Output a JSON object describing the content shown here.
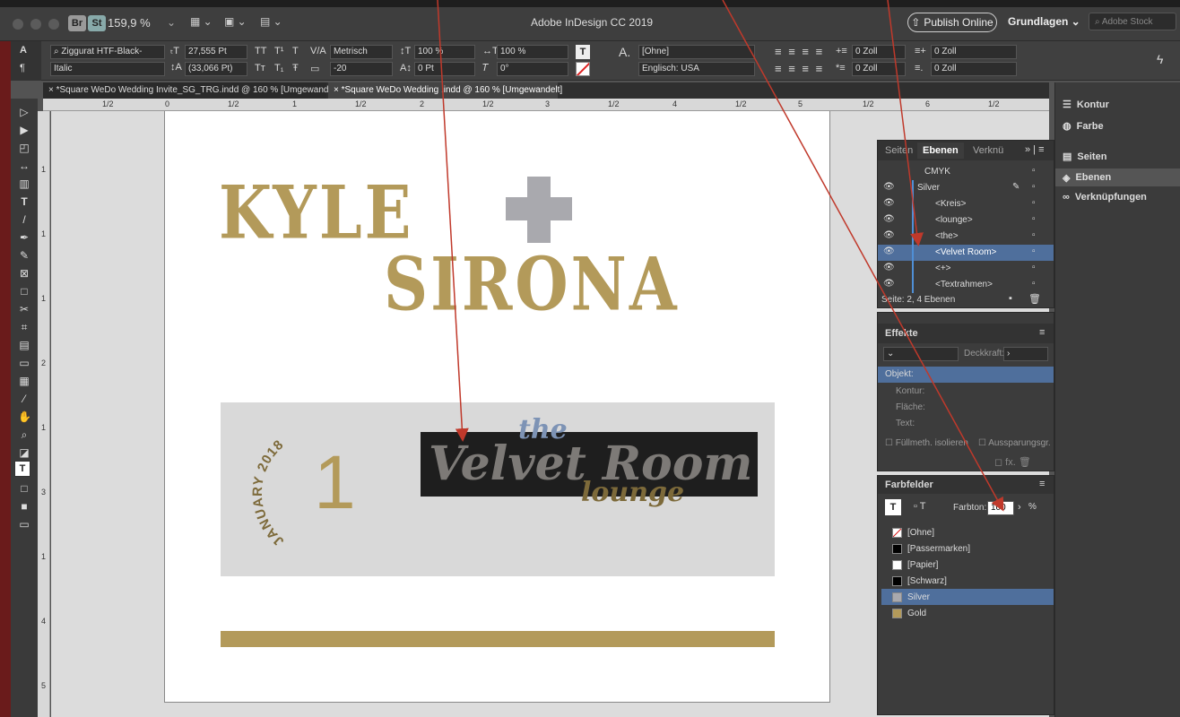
{
  "app": {
    "window_title": "Adobe InDesign CC 2019",
    "zoom": "159,9 %",
    "publish_label": "Publish Online",
    "workspace_label": "Grundlagen",
    "stock_placeholder": "Adobe Stock",
    "badge_br": "Br",
    "badge_st": "St"
  },
  "control": {
    "font_family": "Ziggurat HTF-Black-",
    "font_style": "Italic",
    "font_size": "27,555 Pt",
    "leading": "(33,066 Pt)",
    "kerning": "Metrisch",
    "tracking": "-20",
    "vscale": "100 %",
    "hscale": "100 %",
    "baseline": "0 Pt",
    "skew": "0°",
    "char_style": "[Ohne]",
    "language": "Englisch: USA",
    "indent_left": "0 Zoll",
    "indent_first": "0 Zoll",
    "indent_right": "0 Zoll",
    "indent_last": "0 Zoll",
    "space_before": "0 Zoll",
    "space_after": "0 Zoll",
    "tt1": "TT",
    "tt2": "T¹",
    "tt3": "T",
    "tt4": "Tт",
    "tt5": "T₁",
    "tt6": "Ŧ"
  },
  "tabs": [
    {
      "label": "*Square WeDo Wedding Invite_SG_TRG.indd @ 160 % [Umgewandelt]"
    },
    {
      "label": "*Square WeDo Wedding .indd @ 160 % [Umgewandelt]"
    }
  ],
  "ruler_h": [
    "1/2",
    "0",
    "1/2",
    "1",
    "1/2",
    "2",
    "1/2",
    "3",
    "1/2",
    "4",
    "1/2",
    "5",
    "1/2",
    "6",
    "1/2"
  ],
  "ruler_v": [
    "1",
    "1",
    "1",
    "2",
    "1",
    "3",
    "1",
    "4",
    "1",
    "5"
  ],
  "document": {
    "name_line1": "KYLE",
    "name_line2": "SIRONA",
    "date_arc": "JANUARY 2018",
    "date_number": "1",
    "the": "the",
    "venue": "Velvet Room",
    "lounge": "lounge"
  },
  "dock": {
    "items": [
      {
        "label": "Kontur"
      },
      {
        "label": "Farbe"
      },
      {
        "label": "Seiten"
      },
      {
        "label": "Ebenen"
      },
      {
        "label": "Verknüpfungen"
      }
    ]
  },
  "layers": {
    "tabs": [
      "Seiten",
      "Ebenen",
      "Verknü"
    ],
    "rows": [
      {
        "label": "CMYK"
      },
      {
        "label": "Silver"
      },
      {
        "label": "<Kreis>"
      },
      {
        "label": "<lounge>"
      },
      {
        "label": "<the>"
      },
      {
        "label": "<Velvet Room>"
      },
      {
        "label": "<+>"
      },
      {
        "label": "<Textrahmen>"
      }
    ],
    "footer": "Seite: 2, 4 Ebenen"
  },
  "effects": {
    "title": "Effekte",
    "opacity_label": "Deckkraft:",
    "object_label": "Objekt:",
    "stroke_label": "Kontur:",
    "fill_label": "Fläche:",
    "text_label": "Text:",
    "isolate_label": "Füllmeth. isolieren",
    "knockout_label": "Aussparungsgr."
  },
  "swatches": {
    "title": "Farbfelder",
    "tint_label": "Farbton:",
    "tint_value": "100",
    "pct": "%",
    "rows": [
      {
        "label": "[Ohne]",
        "color": "#ffffff"
      },
      {
        "label": "[Passermarken]",
        "color": "#000000"
      },
      {
        "label": "[Papier]",
        "color": "#ffffff"
      },
      {
        "label": "[Schwarz]",
        "color": "#000000"
      },
      {
        "label": "Silver",
        "color": "#a9a9ae"
      },
      {
        "label": "Gold",
        "color": "#b39a5a"
      }
    ]
  },
  "colors": {
    "gold": "#b39a5a",
    "silver": "#a9a9ae",
    "selection": "#4f6f9c",
    "arrow": "#c0392b"
  }
}
